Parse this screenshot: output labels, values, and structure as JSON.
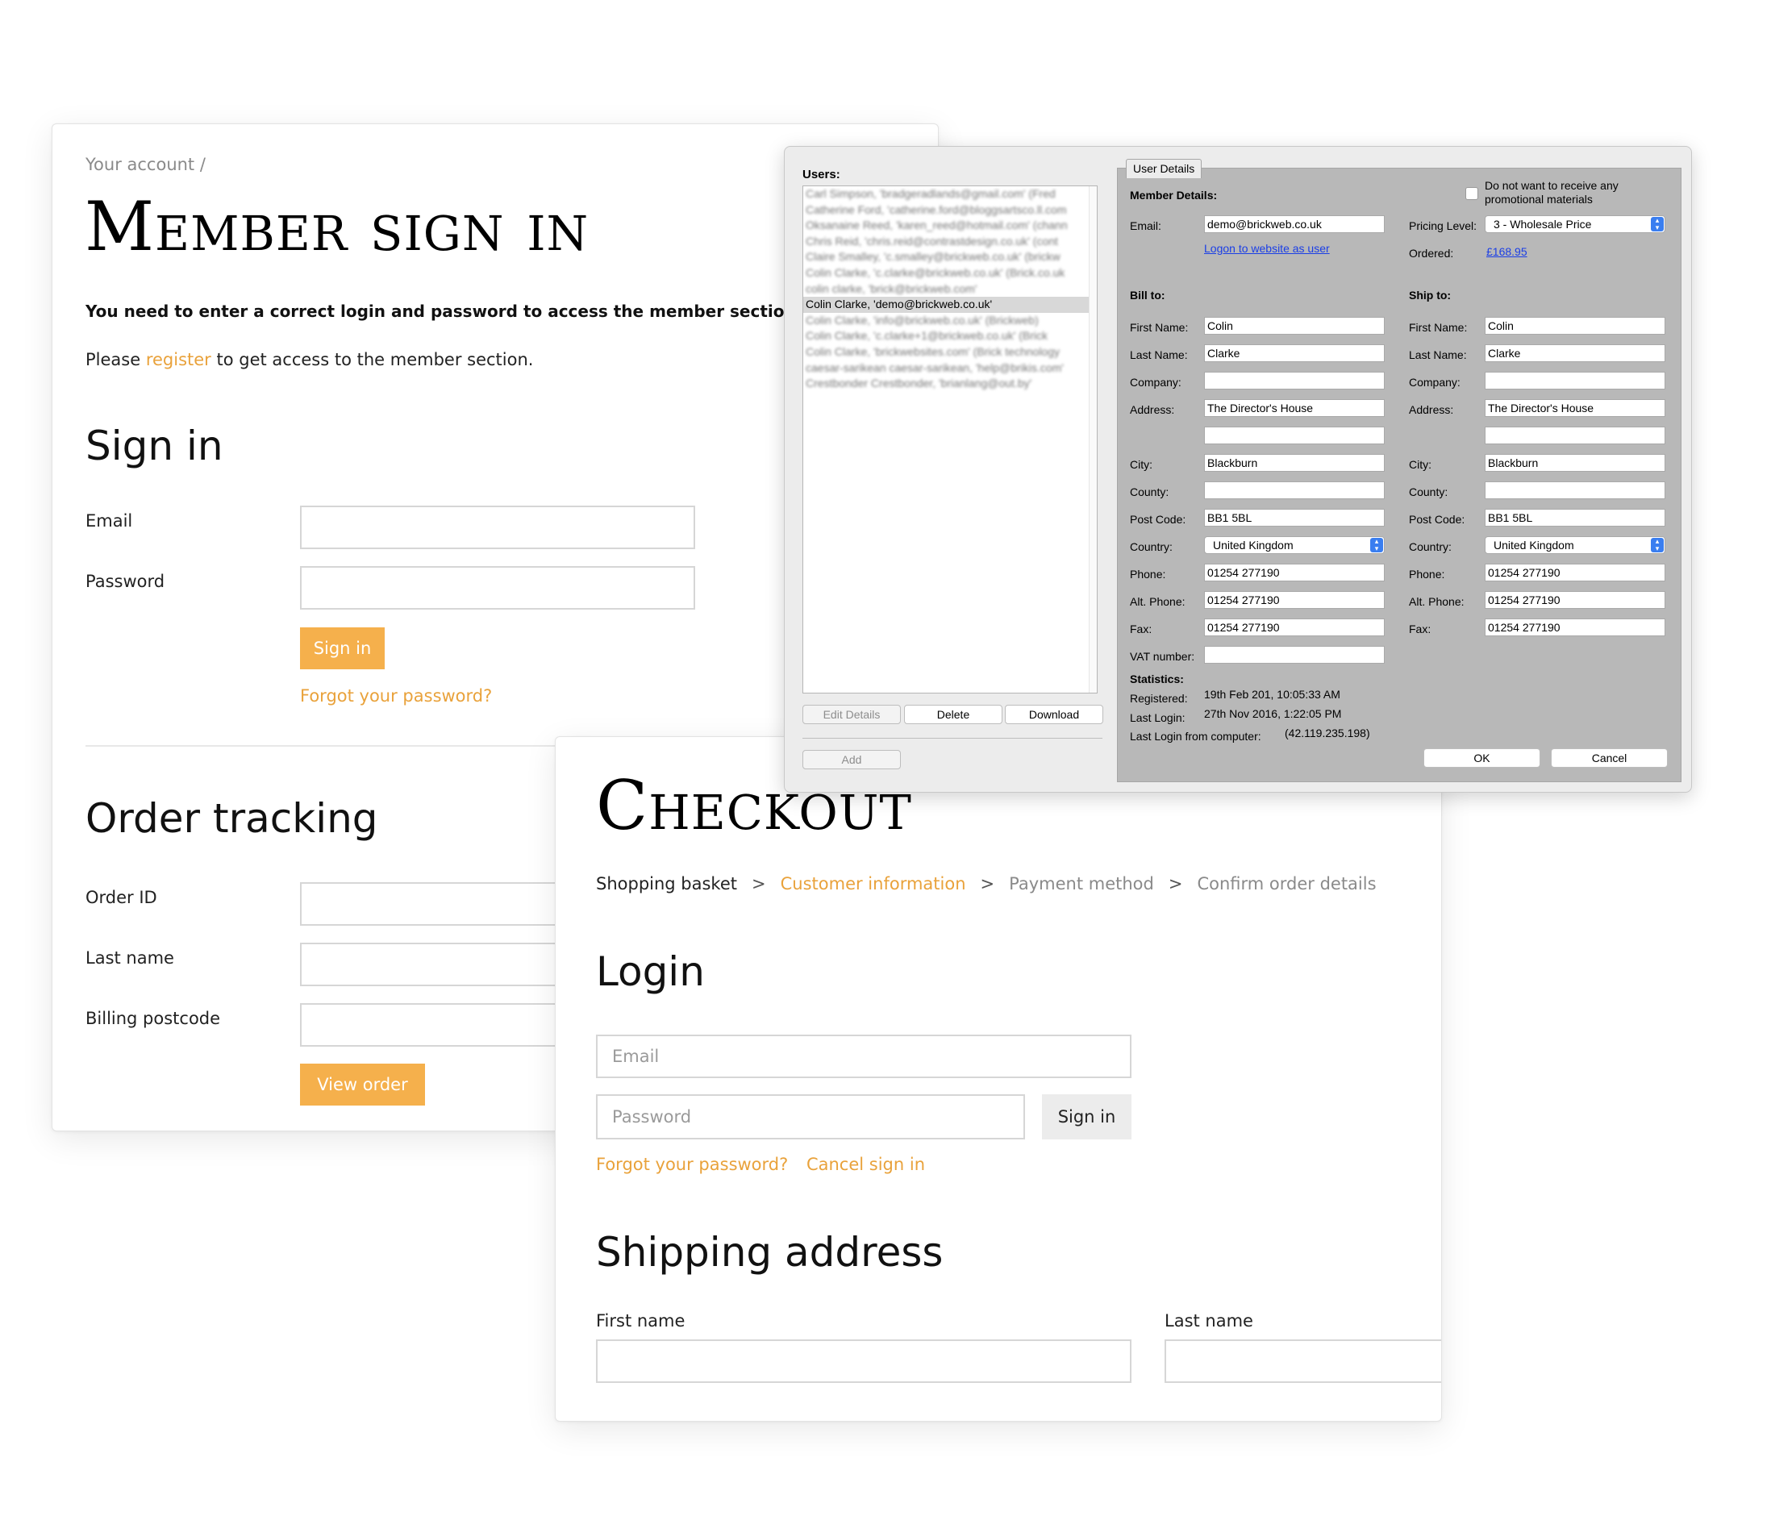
{
  "member_panel": {
    "breadcrumb": "Your account  /",
    "title": "Member sign in",
    "notice": "You need to enter a correct login and password to access the member section",
    "register_prefix": "Please ",
    "register_link": "register",
    "register_suffix": " to get access to the member section.",
    "signin_heading": "Sign in",
    "email_label": "Email",
    "password_label": "Password",
    "signin_button": "Sign in",
    "forgot_link": "Forgot your password?",
    "tracking_heading": "Order tracking",
    "order_id_label": "Order ID",
    "last_name_label": "Last name",
    "billing_postcode_label": "Billing postcode",
    "view_order_button": "View order"
  },
  "checkout_panel": {
    "title": "Checkout",
    "steps": {
      "step1": "Shopping basket",
      "step2": "Customer information",
      "step3": "Payment method",
      "step4": "Confirm order details",
      "separator": ">"
    },
    "login_heading": "Login",
    "email_placeholder": "Email",
    "password_placeholder": "Password",
    "signin_button": "Sign in",
    "forgot_link": "Forgot your password?",
    "cancel_link": "Cancel sign in",
    "shipping_heading": "Shipping address",
    "first_name_label": "First name",
    "last_name_label": "Last name"
  },
  "admin_dialog": {
    "users_label": "Users:",
    "users": [
      "Carl Simpson, 'bradgeradlands@gmail.com' (Fred",
      "Catherine Ford, 'catherine.ford@bloggsartsco.ll.com",
      "Oksanaine Reed, 'karen_reed@hotmail.com' (chann",
      "Chris Reid, 'chris.reid@contrastdesign.co.uk' (cont",
      "Claire Smalley, 'c.smalley@brickweb.co.uk' (brickw",
      "Colin Clarke, 'c.clarke@brickweb.co.uk' (Brick.co.uk",
      "colin clarke, 'brick@brickweb.com'",
      "Colin Clarke, 'demo@brickweb.co.uk'",
      "Colin Clarke, 'info@brickweb.co.uk' (Brickweb)",
      "Colin Clarke, 'c.clarke+1@brickweb.co.uk' (Brick",
      "Colin Clarke, 'brickwebsites.com' (Brick technology",
      "caesar-sarikean caesar-sarikean, 'help@brikis.com'",
      "Crestbonder Crestbonder, 'brianlang@out.by'"
    ],
    "selected_user_index": 7,
    "buttons": {
      "edit_details": "Edit Details",
      "delete": "Delete",
      "download": "Download",
      "add": "Add",
      "ok": "OK",
      "cancel": "Cancel"
    },
    "tab_label": "User Details",
    "member_details_label": "Member Details:",
    "promo_label": "Do not want to receive any promotional materials",
    "email_label": "Email:",
    "email_value": "demo@brickweb.co.uk",
    "logon_link": "Logon to website as user",
    "pricing_level_label": "Pricing Level:",
    "pricing_level_value": "3 - Wholesale Price",
    "ordered_label": "Ordered:",
    "ordered_value": "£168.95",
    "bill_to_label": "Bill to:",
    "ship_to_label": "Ship to:",
    "labels": {
      "first_name": "First Name:",
      "last_name": "Last Name:",
      "company": "Company:",
      "address": "Address:",
      "city": "City:",
      "county": "County:",
      "post_code": "Post Code:",
      "country": "Country:",
      "phone": "Phone:",
      "alt_phone": "Alt. Phone:",
      "fax": "Fax:",
      "vat_number": "VAT number:"
    },
    "bill": {
      "first_name": "Colin",
      "last_name": "Clarke",
      "company": "",
      "address1": "The Director's House",
      "address2": "",
      "city": "Blackburn",
      "county": "",
      "post_code": "BB1 5BL",
      "country": "United Kingdom",
      "phone": "01254 277190",
      "alt_phone": "01254 277190",
      "fax": "01254 277190",
      "vat_number": ""
    },
    "ship": {
      "first_name": "Colin",
      "last_name": "Clarke",
      "company": "",
      "address1": "The Director's House",
      "address2": "",
      "city": "Blackburn",
      "county": "",
      "post_code": "BB1 5BL",
      "country": "United Kingdom",
      "phone": "01254 277190",
      "alt_phone": "01254 277190",
      "fax": "01254 277190"
    },
    "statistics_label": "Statistics:",
    "registered_label": "Registered:",
    "registered_value": "19th Feb 201, 10:05:33 AM",
    "last_login_label": "Last Login:",
    "last_login_value": "27th Nov 2016, 1:22:05 PM",
    "last_login_computer_label": "Last Login from computer:",
    "last_login_computer_value": "(42.119.235.198)"
  },
  "colors": {
    "accent_orange": "#f5b04c",
    "link_orange": "#e9a23b",
    "dialog_group_bg": "#b8b8b8",
    "mac_blue": "#3a7ef0"
  }
}
